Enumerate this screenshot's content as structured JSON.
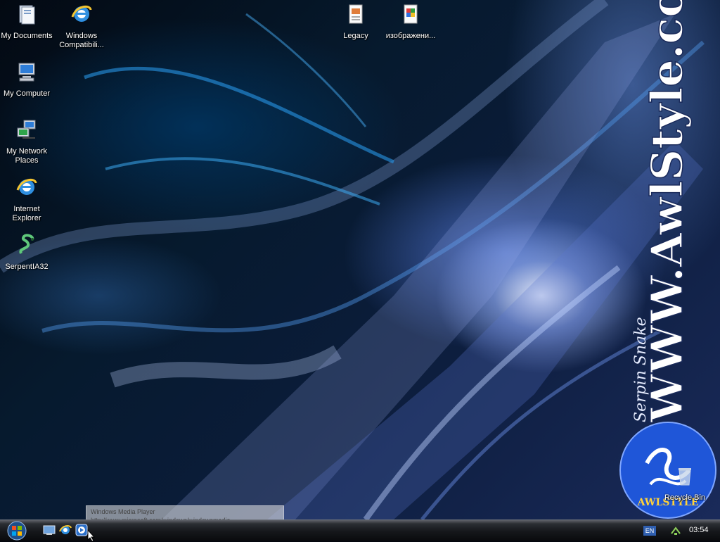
{
  "desktop": {
    "icons": [
      {
        "id": "my-documents",
        "label": "My Documents",
        "icon": "folder-documents-icon"
      },
      {
        "id": "windows-compat",
        "label": "Windows\nCompatibili...",
        "icon": "ie-icon"
      },
      {
        "id": "legacy",
        "label": "Legacy",
        "icon": "document-icon"
      },
      {
        "id": "images",
        "label": "изображени...",
        "icon": "image-file-icon"
      },
      {
        "id": "my-computer",
        "label": "My Computer",
        "icon": "computer-icon"
      },
      {
        "id": "network",
        "label": "My Network\nPlaces",
        "icon": "network-icon"
      },
      {
        "id": "ie",
        "label": "Internet\nExplorer",
        "icon": "ie-icon"
      },
      {
        "id": "serpent",
        "label": "SerpentIA32",
        "icon": "serpent-icon"
      },
      {
        "id": "recycle-bin",
        "label": "Recycle Bin",
        "icon": "recycle-bin-icon"
      }
    ],
    "wallpaper": {
      "url_text": "WWW.AwlStyle.com",
      "signature": "Serpin Snake",
      "logo_text": "AWLSTYLE"
    }
  },
  "taskbar": {
    "quick_launch": [
      "show-desktop-icon",
      "ie-icon",
      "media-player-icon"
    ],
    "tooltip": [
      "Windows Media Player",
      "http://www.microsoft.com/windows/windowsmedia"
    ],
    "language": "EN",
    "clock": "03:54"
  },
  "colors": {
    "taskbar": "#15171b",
    "accent": "#2f5fb0",
    "label": "#ffffff"
  }
}
